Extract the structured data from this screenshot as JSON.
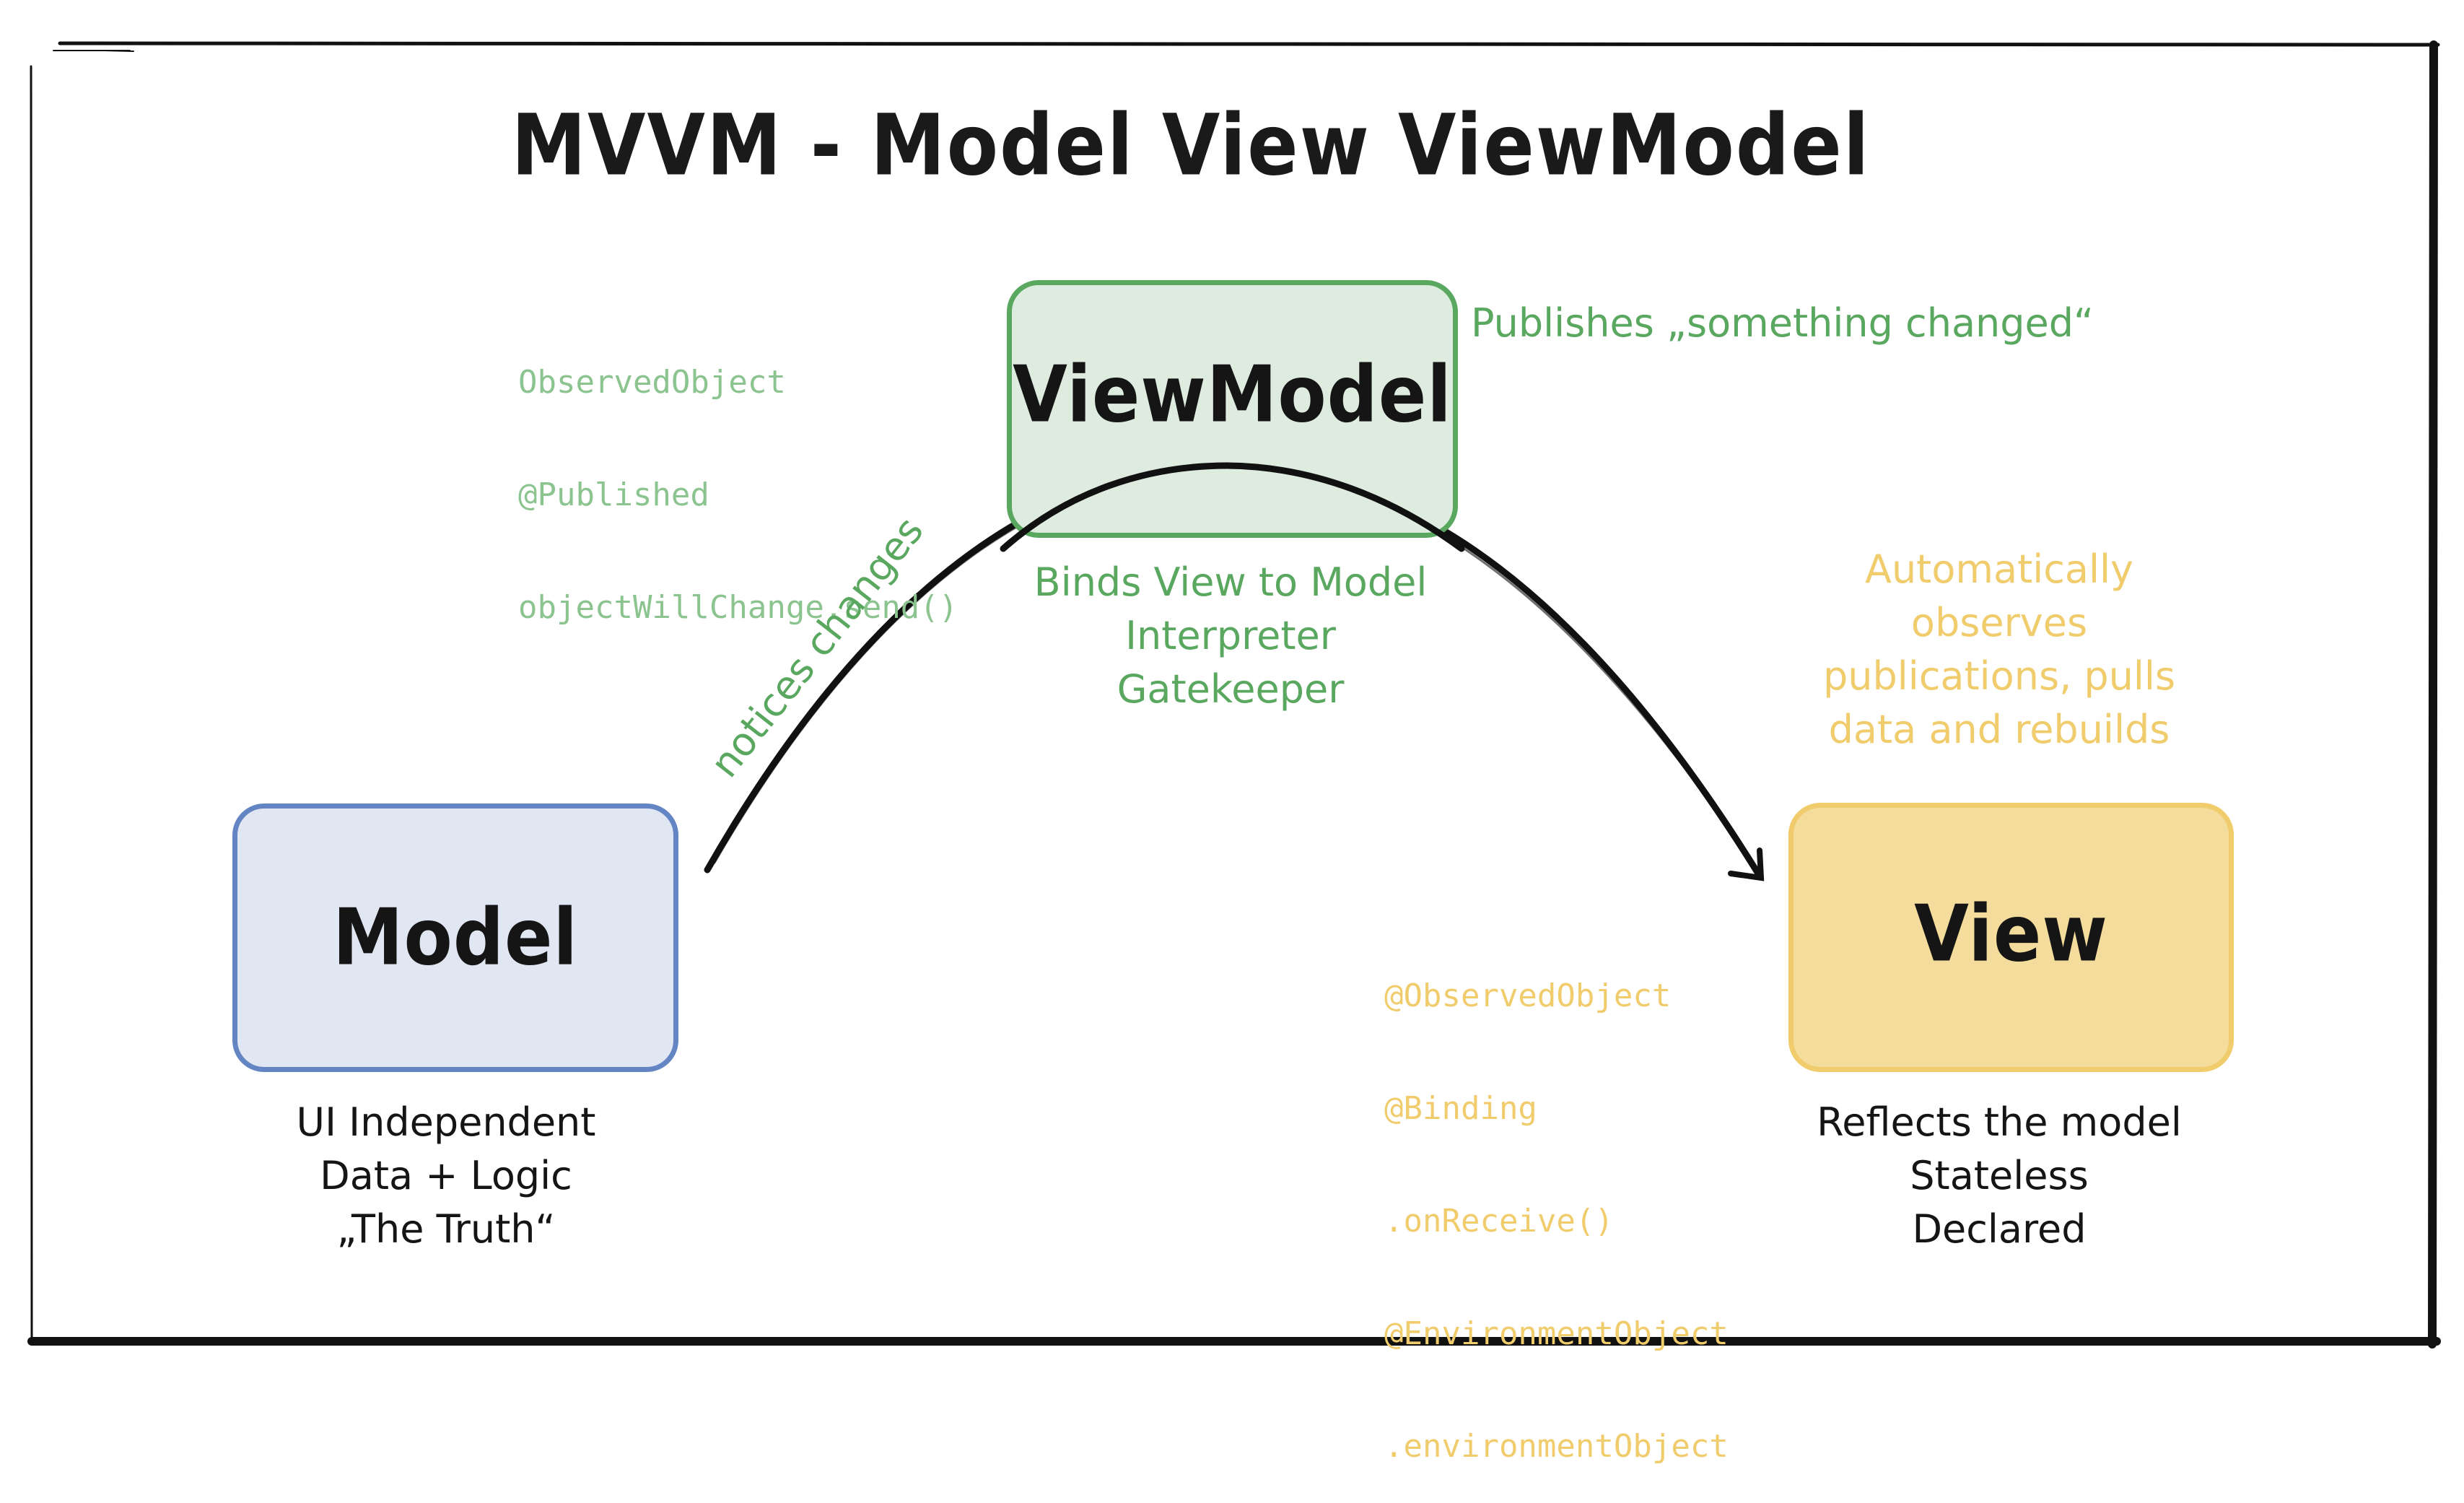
{
  "title": "MVVM - Model View ViewModel",
  "colors": {
    "ink": "#151515",
    "green": "#5aa860",
    "green_light": "#8cc490",
    "green_fill": "#deecdf",
    "blue": "#6485c4",
    "blue_fill": "#e0e6f2",
    "yellow": "#f0cc6c",
    "yellow_fill": "#f4dc9c"
  },
  "model": {
    "label": "Model",
    "description": [
      "UI Independent",
      "Data + Logic",
      "„The Truth“"
    ]
  },
  "viewmodel": {
    "label": "ViewModel",
    "code": [
      "ObservedObject",
      "@Published",
      "objectWillChange.send()"
    ],
    "publishes_note": "Publishes „something changed“",
    "description": [
      "Binds View to Model",
      "Interpreter",
      "Gatekeeper"
    ]
  },
  "view": {
    "label": "View",
    "observes_note": [
      "Automatically",
      "observes",
      "publications, pulls",
      "data and rebuilds"
    ],
    "code": [
      "@ObservedObject",
      "@Binding",
      ".onReceive()",
      "@EnvironmentObject",
      ".environmentObject"
    ],
    "description": [
      "Reflects the model",
      "Stateless",
      "Declared"
    ]
  },
  "arrow": {
    "label": "notices changes",
    "from": "Model",
    "to": "View",
    "via": "ViewModel"
  }
}
